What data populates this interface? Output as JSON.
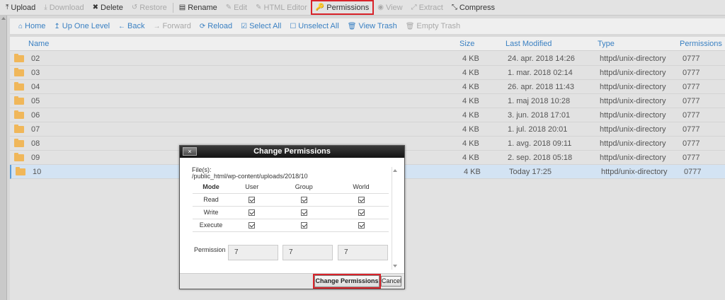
{
  "toolbar": {
    "upload": "Upload",
    "download": "Download",
    "delete": "Delete",
    "restore": "Restore",
    "rename": "Rename",
    "edit": "Edit",
    "html_editor": "HTML Editor",
    "permissions": "Permissions",
    "view": "View",
    "extract": "Extract",
    "compress": "Compress"
  },
  "nav": {
    "home": "Home",
    "up_one_level": "Up One Level",
    "back": "Back",
    "forward": "Forward",
    "reload": "Reload",
    "select_all": "Select All",
    "unselect_all": "Unselect All",
    "view_trash": "View Trash",
    "empty_trash": "Empty Trash"
  },
  "columns": {
    "name": "Name",
    "size": "Size",
    "modified": "Last Modified",
    "type": "Type",
    "permissions": "Permissions"
  },
  "files": [
    {
      "name": "02",
      "size": "4 KB",
      "modified": "24. apr. 2018 14:26",
      "type": "httpd/unix-directory",
      "perms": "0777"
    },
    {
      "name": "03",
      "size": "4 KB",
      "modified": "1. mar. 2018 02:14",
      "type": "httpd/unix-directory",
      "perms": "0777"
    },
    {
      "name": "04",
      "size": "4 KB",
      "modified": "26. apr. 2018 11:43",
      "type": "httpd/unix-directory",
      "perms": "0777"
    },
    {
      "name": "05",
      "size": "4 KB",
      "modified": "1. maj 2018 10:28",
      "type": "httpd/unix-directory",
      "perms": "0777"
    },
    {
      "name": "06",
      "size": "4 KB",
      "modified": "3. jun. 2018 17:01",
      "type": "httpd/unix-directory",
      "perms": "0777"
    },
    {
      "name": "07",
      "size": "4 KB",
      "modified": "1. jul. 2018 20:01",
      "type": "httpd/unix-directory",
      "perms": "0777"
    },
    {
      "name": "08",
      "size": "4 KB",
      "modified": "1. avg. 2018 09:11",
      "type": "httpd/unix-directory",
      "perms": "0777"
    },
    {
      "name": "09",
      "size": "4 KB",
      "modified": "2. sep. 2018 05:18",
      "type": "httpd/unix-directory",
      "perms": "0777"
    },
    {
      "name": "10",
      "size": "4 KB",
      "modified": "Today 17:25",
      "type": "httpd/unix-directory",
      "perms": "0777",
      "selected": true
    }
  ],
  "dialog": {
    "title": "Change Permissions",
    "close": "×",
    "files_label": "File(s):",
    "files_path": "/public_html/wp-content/uploads/2018/10",
    "headers": {
      "mode": "Mode",
      "user": "User",
      "group": "Group",
      "world": "World"
    },
    "rows": {
      "read": "Read",
      "write": "Write",
      "execute": "Execute"
    },
    "permission_label": "Permission",
    "values": {
      "user": "7",
      "group": "7",
      "world": "7"
    },
    "checked": {
      "read": [
        true,
        true,
        true
      ],
      "write": [
        true,
        true,
        true
      ],
      "execute": [
        true,
        true,
        true
      ]
    },
    "submit": "Change Permissions",
    "cancel": "Cancel"
  },
  "colors": {
    "accent": "#3a80c2",
    "highlight": "#d9232a",
    "folder": "#f0b75a",
    "selected_row": "#d3e3f3"
  }
}
